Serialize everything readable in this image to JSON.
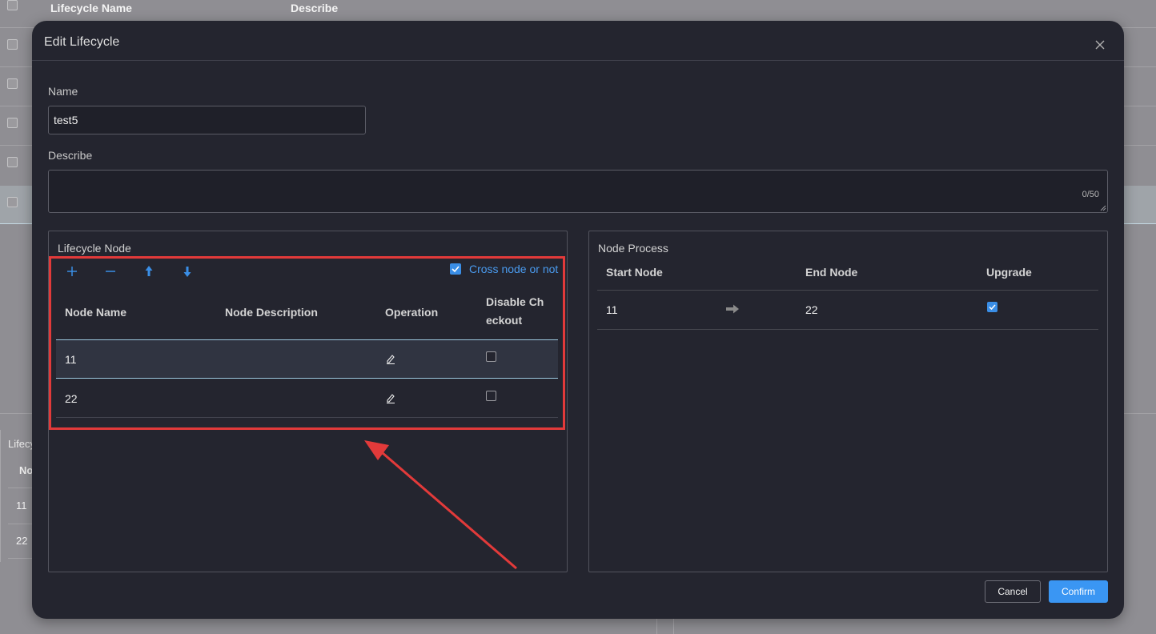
{
  "background": {
    "header": {
      "col_name": "Lifecycle Name",
      "col_describe": "Describe"
    },
    "lower_panel": {
      "title": "Lifecy",
      "col": "No",
      "rows": [
        "11",
        "22"
      ]
    }
  },
  "modal": {
    "title": "Edit Lifecycle",
    "close_icon": "close-icon",
    "name_label": "Name",
    "name_value": "test5",
    "describe_label": "Describe",
    "describe_counter": "0/50"
  },
  "lifecycle_node": {
    "title": "Lifecycle Node",
    "toolbar": {
      "add_icon": "plus-icon",
      "remove_icon": "minus-icon",
      "up_icon": "arrow-up-icon",
      "down_icon": "arrow-down-icon"
    },
    "cross_node_label": "Cross node or not",
    "cross_node_checked": true,
    "columns": {
      "node_name": "Node Name",
      "node_description": "Node Description",
      "operation": "Operation",
      "disable_checkout_line1": "Disable Ch",
      "disable_checkout_line2": "eckout"
    },
    "rows": [
      {
        "name": "11",
        "description": "",
        "disable_checkout": false
      },
      {
        "name": "22",
        "description": "",
        "disable_checkout": false
      }
    ]
  },
  "node_process": {
    "title": "Node Process",
    "columns": {
      "start": "Start Node",
      "end": "End Node",
      "upgrade": "Upgrade"
    },
    "rows": [
      {
        "start": "11",
        "end": "22",
        "upgrade": true
      }
    ]
  },
  "footer": {
    "cancel": "Cancel",
    "confirm": "Confirm"
  },
  "colors": {
    "accent": "#3a96f3",
    "highlight": "#e23a3a",
    "modal_bg": "#24252f"
  }
}
